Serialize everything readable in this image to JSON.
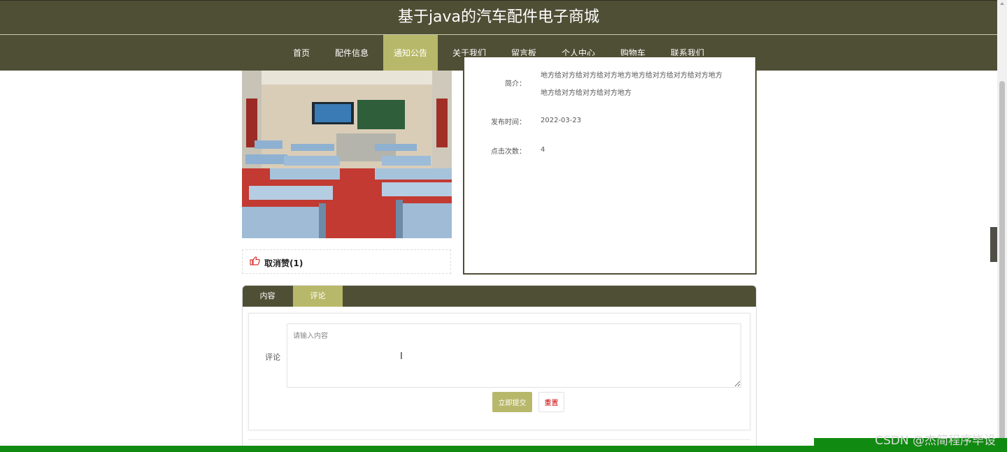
{
  "site": {
    "title": "基于java的汽车配件电子商城"
  },
  "nav": {
    "items": [
      {
        "label": "首页"
      },
      {
        "label": "配件信息"
      },
      {
        "label": "通知公告"
      },
      {
        "label": "关于我们"
      },
      {
        "label": "留言板"
      },
      {
        "label": "个人中心"
      },
      {
        "label": "购物车"
      },
      {
        "label": "联系我们"
      }
    ],
    "active": "通知公告"
  },
  "detail": {
    "intro_label": "简介：",
    "intro_line1": "地方给对方给对方给对方地方地方给对方给对方给对方地方",
    "intro_line2": "地方给对方给对方给对方地方",
    "publish_label": "发布时间：",
    "publish_value": "2022-03-23",
    "clicks_label": "点击次数：",
    "clicks_value": "4"
  },
  "like": {
    "label": "取消赞(1)"
  },
  "tabs": [
    {
      "label": "内容"
    },
    {
      "label": "评论"
    }
  ],
  "comment": {
    "label": "评论",
    "placeholder": "请输入内容",
    "submit_label": "立即提交",
    "reset_label": "重置"
  },
  "watermark": "CSDN @杰简程序毕设",
  "colors": {
    "header_bg": "#4f4f36",
    "accent": "#b8b86a",
    "bottom_bar": "#118a11",
    "reset_text": "#cc0000"
  },
  "icons": {
    "like": "thumbs-up-icon",
    "side_tab": "chevron-left-icon"
  }
}
